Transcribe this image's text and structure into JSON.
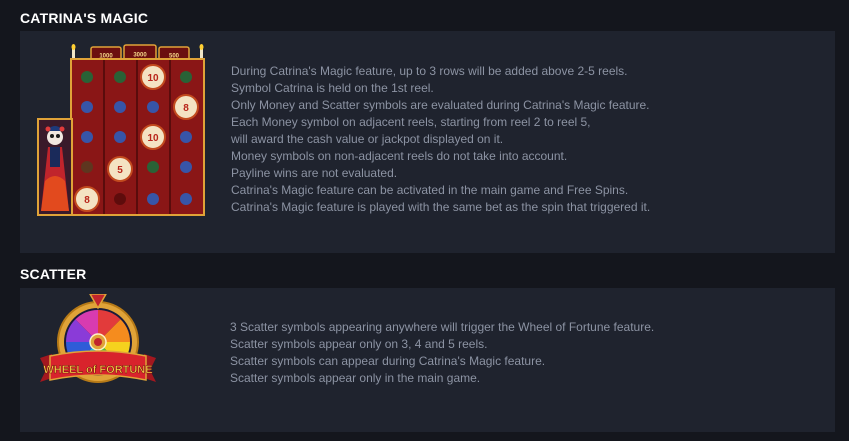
{
  "sections": [
    {
      "title": "CATRINA'S MAGIC",
      "illustration": "catrina-magic-reels-image",
      "lines": [
        "During Catrina's Magic feature, up to 3 rows will be added above 2-5 reels.",
        "Symbol Catrina is held on the 1st reel.",
        "Only Money and Scatter symbols are evaluated during Catrina's Magic feature.",
        "Each Money symbol on adjacent reels, starting from reel 2 to reel 5,",
        "will award the cash value or jackpot displayed on it.",
        "Money symbols on non-adjacent reels do not take into account.",
        "Payline wins are not evaluated.",
        "Catrina's Magic feature can be activated in the main game and Free Spins.",
        "Catrina's Magic feature is played with the same bet as the spin that triggered it."
      ],
      "image_labels": {
        "jackpot_plaques": [
          "1000",
          "3000",
          "500"
        ],
        "money_values": [
          "10",
          "8",
          "10",
          "5",
          "8"
        ]
      }
    },
    {
      "title": "SCATTER",
      "illustration": "wheel-of-fortune-scatter-image",
      "lines": [
        "3 Scatter symbols appearing anywhere will trigger the Wheel of Fortune feature.",
        "Scatter symbols appear only on 3, 4 and 5 reels.",
        "Scatter symbols can appear during Catrina's Magic feature.",
        "Scatter symbols appear only in the main game."
      ],
      "logo_text": "WHEEL of FORTUNE"
    }
  ],
  "colors": {
    "page_bg": "#14161d",
    "panel_bg": "#1f232e",
    "title": "#ffffff",
    "text": "#8c93a3",
    "reel_red": "#8a1616",
    "gold": "#e0a338"
  }
}
